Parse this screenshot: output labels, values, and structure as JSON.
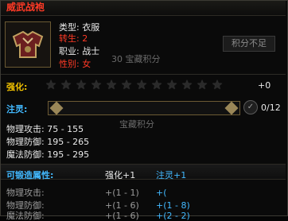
{
  "title": "威武战袍",
  "item": {
    "icon": "armor-icon",
    "props": [
      {
        "label": "类型:",
        "value": "衣服"
      },
      {
        "label": "转生:",
        "value": "2"
      },
      {
        "label": "职业:",
        "value": "战士"
      },
      {
        "label": "性别:",
        "value": "女"
      }
    ]
  },
  "bind_button": "积分不足",
  "watermark_points": "30 宝藏积分",
  "upgrade": {
    "label": "强化:",
    "stars_total": 12,
    "stars_filled": 0,
    "bonus": "+0"
  },
  "soul": {
    "label": "注灵:",
    "progress_text": "0/12",
    "progress": 0,
    "ghost_text": "宝藏积分"
  },
  "stats": [
    {
      "label": "物理攻击:",
      "value": "75 - 155"
    },
    {
      "label": "物理防御:",
      "value": "195 - 265"
    },
    {
      "label": "魔法防御:",
      "value": "195 - 295"
    }
  ],
  "forge": {
    "header": "可锻造属性:",
    "col_upgrade": "强化+1",
    "col_soul": "注灵+1",
    "rows": [
      {
        "label": "物理攻击:",
        "upgrade": "+(1 - 1)",
        "soul": "+("
      },
      {
        "label": "物理防御:",
        "upgrade": "+(1 - 6)",
        "soul": "+(1 - 8)"
      },
      {
        "label": "魔法防御:",
        "upgrade": "+(1 - 6)",
        "soul": "+(2 - 2)"
      }
    ]
  },
  "colors": {
    "title": "#ff3a26",
    "accent_cyan": "#42b9ff",
    "accent_orange": "#f2c200",
    "frame_gold": "#6d5b34"
  }
}
